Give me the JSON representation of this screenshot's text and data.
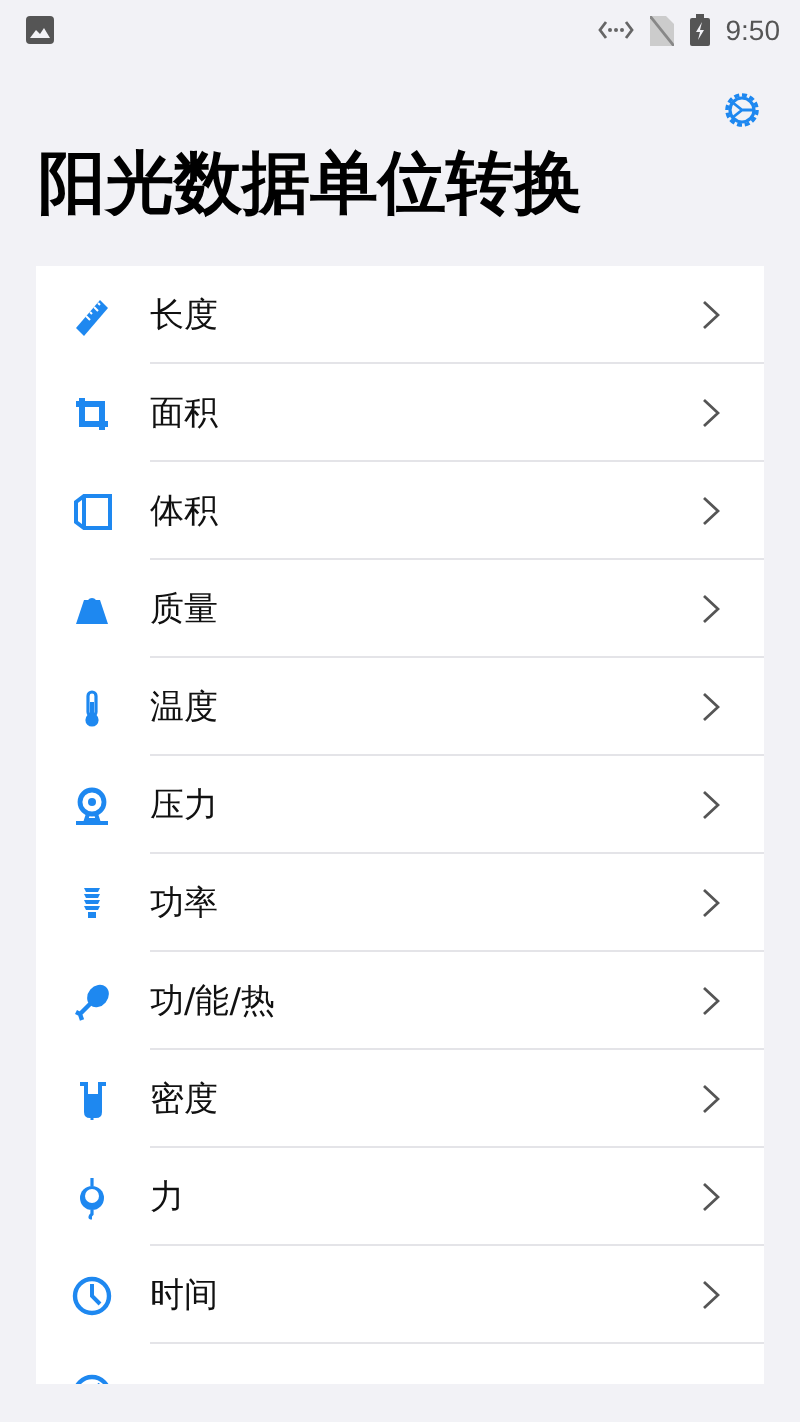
{
  "status_bar": {
    "time": "9:50"
  },
  "title": "阳光数据单位转换",
  "items": [
    {
      "label": "长度"
    },
    {
      "label": "面积"
    },
    {
      "label": "体积"
    },
    {
      "label": "质量"
    },
    {
      "label": "温度"
    },
    {
      "label": "压力"
    },
    {
      "label": "功率"
    },
    {
      "label": "功/能/热"
    },
    {
      "label": "密度"
    },
    {
      "label": "力"
    },
    {
      "label": "时间"
    },
    {
      "cut_off": true
    }
  ]
}
